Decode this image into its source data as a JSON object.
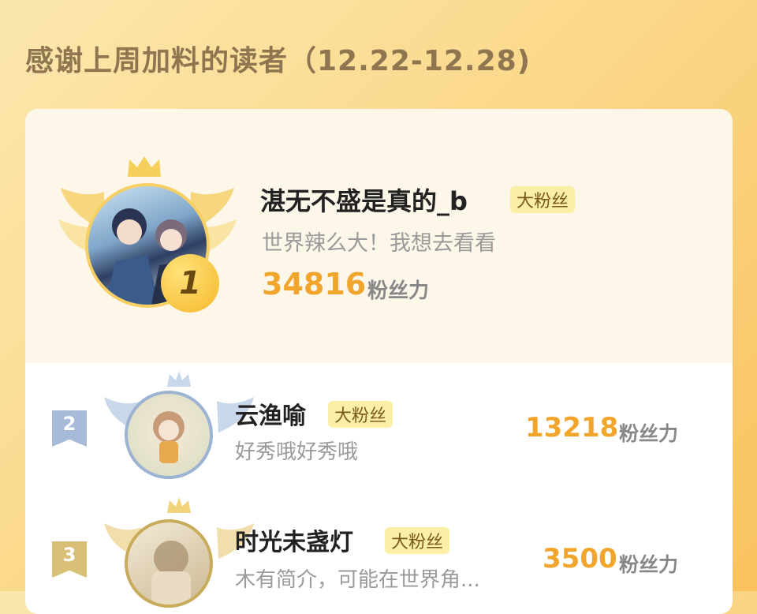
{
  "page": {
    "title": "感谢上周加料的读者（12.22-12.28)"
  },
  "colors": {
    "accent": "#f2a52c",
    "badge_bg": "#fbefa6",
    "rank2": "#8fa9cf",
    "rank3": "#d2b66a"
  },
  "first": {
    "rank": "1",
    "name": "湛无不盛是真的_b",
    "badge": "大粉丝",
    "bio": "世界辣么大！我想去看看",
    "score": "34816",
    "unit": "粉丝力"
  },
  "rows": [
    {
      "rank": "2",
      "name": "云渔喻",
      "badge": "大粉丝",
      "bio": "好秀哦好秀哦",
      "score": "13218",
      "unit": "粉丝力"
    },
    {
      "rank": "3",
      "name": "时光未盏灯",
      "badge": "大粉丝",
      "bio": "木有简介，可能在世界角...",
      "score": "3500",
      "unit": "粉丝力"
    }
  ]
}
